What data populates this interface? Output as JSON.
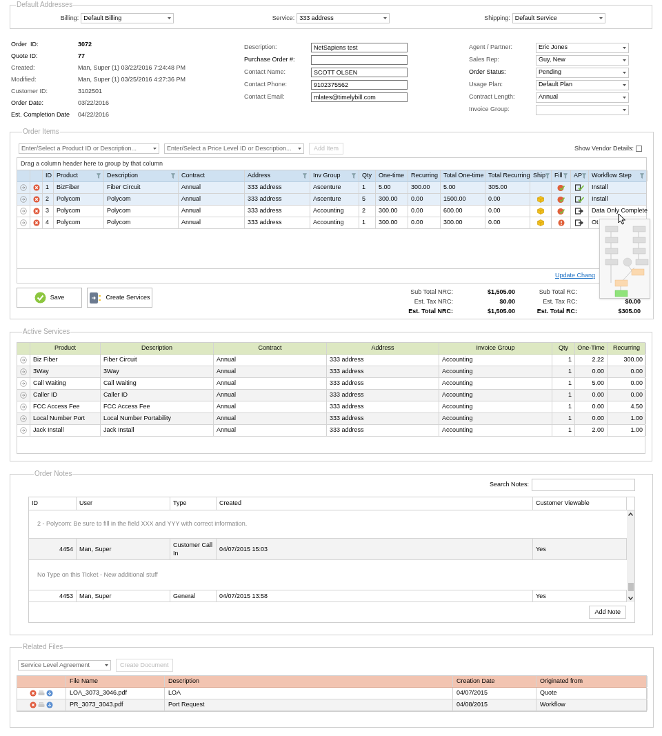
{
  "default_addresses": {
    "title": "Default Addresses",
    "fields": [
      {
        "label": "Billing:",
        "value": "Default Billing"
      },
      {
        "label": "Service:",
        "value": "333 address"
      },
      {
        "label": "Shipping:",
        "value": "Default Service"
      }
    ]
  },
  "order_info": {
    "details": [
      {
        "label": "Order  ID:",
        "value": "3072",
        "required": true,
        "kind": "key"
      },
      {
        "label": "Quote ID:",
        "value": "77",
        "required": true,
        "kind": "key"
      },
      {
        "label": "Created:",
        "value": "Man, Super (1) 03/22/2016 7:24:48 PM",
        "required": false,
        "kind": "plain"
      },
      {
        "label": "Modified:",
        "value": "Man, Super (1) 03/25/2016 4:27:36 PM",
        "required": false,
        "kind": "plain"
      },
      {
        "label": "Customer ID:",
        "value": "3102501",
        "required": false,
        "kind": "plain"
      },
      {
        "label": "Order Date:",
        "value": "03/22/2016",
        "required": true,
        "kind": "plain"
      },
      {
        "label": "Est. Completion Date",
        "value": "04/22/2016",
        "required": true,
        "kind": "plain"
      }
    ],
    "contact_fields": [
      {
        "label": "Description:",
        "value": "NetSapiens test",
        "required": false
      },
      {
        "label": "Purchase Order #:",
        "required": true
      },
      {
        "label": "Contact Name:",
        "value": "SCOTT OLSEN",
        "required": false
      },
      {
        "label": "Contact Phone:",
        "value": "9102375562",
        "required": false
      },
      {
        "label": "Contact Email:",
        "value": "mlates@timelybill.com",
        "required": false
      }
    ],
    "account_fields": [
      {
        "label": "Agent / Partner:",
        "value": "Eric Jones",
        "required": false
      },
      {
        "label": "Sales Rep:",
        "value": "Guy, New",
        "required": false
      },
      {
        "label": "Order Status:",
        "value": "Pending",
        "required": true
      },
      {
        "label": "Usage Plan:",
        "value": "Default Plan",
        "required": false
      },
      {
        "label": "Contract Length:",
        "value": "Annual",
        "required": false
      },
      {
        "label": "Invoice Group:",
        "required": false
      }
    ]
  },
  "order_items": {
    "title": "Order Items",
    "product_select": {
      "placeholder": "Enter/Select a Product ID or Description..."
    },
    "price_select": {
      "placeholder": "Enter/Select a Price Level ID or Description..."
    },
    "add_button": {
      "label": "Add Item",
      "disabled": true
    },
    "vendor_details": {
      "label": "Show Vendor Details:",
      "checked": false
    },
    "group_hint": "Drag a column header here to group by that column",
    "columns": [
      {
        "label": "ID",
        "filter": false
      },
      {
        "label": "Product",
        "filter": true
      },
      {
        "label": "Description",
        "filter": true
      },
      {
        "label": "Contract",
        "filter": false
      },
      {
        "label": "Address",
        "filter": true
      },
      {
        "label": "Inv Group",
        "filter": true
      },
      {
        "label": "Qty",
        "filter": false
      },
      {
        "label": "One-time",
        "filter": false
      },
      {
        "label": "Recurring",
        "filter": false
      },
      {
        "label": "Total One-time",
        "filter": false
      },
      {
        "label": "Total Recurring",
        "filter": false
      },
      {
        "label": "Ship",
        "filter": true
      },
      {
        "label": "Fill",
        "filter": true
      },
      {
        "label": "AP",
        "filter": true
      },
      {
        "label": "Workflow Step",
        "filter": true
      }
    ],
    "rows": [
      {
        "id": "1",
        "product": "BizFiber",
        "description": "Fiber Circuit",
        "contract": "Annual",
        "address": "333 address",
        "inv_group": "Ascenture",
        "qty": "1",
        "one_time": "5.00",
        "recurring": "300.00",
        "total_one_time": "5.00",
        "total_recurring": "305.00",
        "ship": false,
        "fill_alert": false,
        "ap_approved": true,
        "workflow_step": "Install",
        "selected": true
      },
      {
        "id": "2",
        "product": "Polycom",
        "description": "Polycom",
        "contract": "Annual",
        "address": "333 address",
        "inv_group": "Ascenture",
        "qty": "5",
        "one_time": "300.00",
        "recurring": "0.00",
        "total_one_time": "1500.00",
        "total_recurring": "0.00",
        "ship": true,
        "fill_alert": false,
        "ap_approved": true,
        "workflow_step": "Install",
        "selected": true
      },
      {
        "id": "3",
        "product": "Polycom",
        "description": "Polycom",
        "contract": "Annual",
        "address": "333 address",
        "inv_group": "Accounting",
        "qty": "2",
        "one_time": "300.00",
        "recurring": "0.00",
        "total_one_time": "600.00",
        "total_recurring": "0.00",
        "ship": true,
        "fill_alert": false,
        "ap_approved": false,
        "workflow_step": "Data Only Complete",
        "selected": false
      },
      {
        "id": "4",
        "product": "Polycom",
        "description": "Polycom",
        "contract": "Annual",
        "address": "333 address",
        "inv_group": "Accounting",
        "qty": "1",
        "one_time": "300.00",
        "recurring": "0.00",
        "total_one_time": "300.00",
        "total_recurring": "0.00",
        "ship": true,
        "fill_alert": true,
        "ap_approved": false,
        "workflow_step": "Ot",
        "selected": false
      }
    ],
    "update_link": "Update Chang",
    "buttons": [
      {
        "label": "Save",
        "kind": "save"
      },
      {
        "label": "Create Services",
        "kind": "create"
      }
    ],
    "totals_nrc": [
      {
        "label": "Sub Total NRC:",
        "value": "$1,505.00",
        "kind": "sub"
      },
      {
        "label": "Est. Tax NRC:",
        "value": "$0.00",
        "kind": "sub"
      },
      {
        "label": "Est. Total NRC:",
        "value": "$1,505.00",
        "kind": "total"
      }
    ],
    "totals_rc": [
      {
        "label": "Sub Total RC:",
        "kind": "sub"
      },
      {
        "label": "Est. Tax RC:",
        "value": "$0.00",
        "kind": "sub"
      },
      {
        "label": "Est. Total RC:",
        "value": "$305.00",
        "kind": "total"
      }
    ]
  },
  "active_services": {
    "title": "Active Services",
    "columns": [
      "Product",
      "Description",
      "Contract",
      "Address",
      "Invoice Group",
      "Qty",
      "One-Time",
      "Recurring"
    ],
    "rows": [
      {
        "product": "Biz Fiber",
        "description": "Fiber Circuit",
        "contract": "Annual",
        "address": "333 address",
        "invoice_group": "Accounting",
        "qty": "1",
        "one_time": "2.22",
        "recurring": "300.00"
      },
      {
        "product": "3Way",
        "description": "3Way",
        "contract": "Annual",
        "address": "333 address",
        "invoice_group": "Accounting",
        "qty": "1",
        "one_time": "0.00",
        "recurring": "0.00"
      },
      {
        "product": "Call Waiting",
        "description": "Call Waiting",
        "contract": "Annual",
        "address": "333 address",
        "invoice_group": "Accounting",
        "qty": "1",
        "one_time": "5.00",
        "recurring": "0.00"
      },
      {
        "product": "Caller ID",
        "description": "Caller ID",
        "contract": "Annual",
        "address": "333 address",
        "invoice_group": "Accounting",
        "qty": "1",
        "one_time": "0.00",
        "recurring": "0.00"
      },
      {
        "product": "FCC Access Fee",
        "description": "FCC Access Fee",
        "contract": "Annual",
        "address": "333 address",
        "invoice_group": "Accounting",
        "qty": "1",
        "one_time": "0.00",
        "recurring": "4.50"
      },
      {
        "product": "Local Number Port",
        "description": "Local Number Portability",
        "contract": "Annual",
        "address": "333 address",
        "invoice_group": "Accounting",
        "qty": "1",
        "one_time": "0.00",
        "recurring": "1.00"
      },
      {
        "product": "Jack Install",
        "description": "Jack Install",
        "contract": "Annual",
        "address": "333 address",
        "invoice_group": "Accounting",
        "qty": "1",
        "one_time": "2.00",
        "recurring": "1.00"
      }
    ]
  },
  "order_notes": {
    "title": "Order Notes",
    "search": {
      "label": "Search Notes:"
    },
    "columns": [
      "ID",
      "User",
      "Type",
      "Created",
      "Customer Viewable"
    ],
    "entries": [
      {
        "kind": "note",
        "text": "2 - Polycom:  Be sure to fill in the field XXX and YYY with correct information."
      },
      {
        "kind": "row",
        "id": "4454",
        "user": "Man, Super",
        "type": "Customer Call In",
        "created": "04/07/2015 15:03",
        "viewable": "Yes"
      },
      {
        "kind": "note",
        "text": "No Type on this Ticket - New additional stuff"
      },
      {
        "kind": "row",
        "id": "4453",
        "user": "Man, Super",
        "type": "General",
        "created": "04/07/2015 13:58",
        "viewable": "Yes"
      }
    ],
    "add_button": "Add Note"
  },
  "related_files": {
    "title": "Related Files",
    "template_select": {
      "value": "Service Level Agreement"
    },
    "create_button": {
      "label": "Create Document",
      "disabled": true
    },
    "columns": [
      "File Name",
      "Description",
      "Creation Date",
      "Originated from"
    ],
    "rows": [
      {
        "file_name": "LOA_3073_3046.pdf",
        "description": "LOA",
        "creation_date": "04/07/2015",
        "originated_from": "Quote"
      },
      {
        "file_name": "PR_3073_3043.pdf",
        "description": "Port Request",
        "creation_date": "04/08/2015",
        "originated_from": "Workflow"
      }
    ]
  }
}
